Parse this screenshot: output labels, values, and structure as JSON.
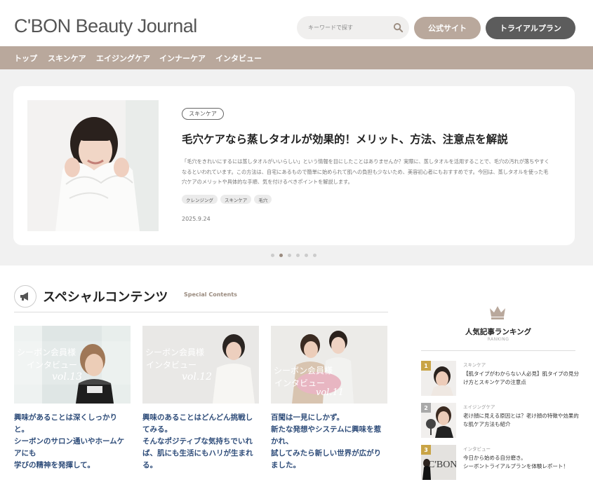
{
  "header": {
    "logo": "C'BON Beauty Journal",
    "search_placeholder": "キーワードで探す",
    "official_label": "公式サイト",
    "trial_label": "トライアルプラン"
  },
  "nav": {
    "items": [
      "トップ",
      "スキンケア",
      "エイジングケア",
      "インナーケア",
      "インタビュー"
    ]
  },
  "hero": {
    "tag": "スキンケア",
    "title": "毛穴ケアなら蒸しタオルが効果的！メリット、方法、注意点を解説",
    "description": "「毛穴をきれいにするには蒸しタオルがいいらしい」という情報を目にしたことはありませんか？実際に、蒸しタオルを活用することで、毛穴の汚れが落ちやすくなるといわれています。この方法は、自宅にあるもので簡単に始められて肌への負担も少ないため、美容初心者にもおすすめです。今回は、蒸しタオルを使った毛穴ケアのメリットや具体的な手順、気を付けるべきポイントを解説します。",
    "pills": [
      "クレンジング",
      "スキンケア",
      "毛穴"
    ],
    "date": "2025.9.24"
  },
  "special": {
    "title": "スペシャルコンテンツ",
    "subtitle": "Special Contents",
    "cards": [
      {
        "overlay_line1": "シーボン会員様",
        "overlay_line2": "インタビュー",
        "vol": "vol.13",
        "text": "興味があることは深くしっかりと。\nシーボンのサロン通いやホームケアにも\n学びの精神を発揮して。"
      },
      {
        "overlay_line1": "シーボン会員様",
        "overlay_line2": "インタビュー",
        "vol": "vol.12",
        "text": "興味のあることはどんどん挑戦してみる。\nそんなポジティブな気持ちでいれば、肌にも生活にもハリが生まれる。"
      },
      {
        "overlay_line1": "シーボン会員様",
        "overlay_line2": "インタビュー",
        "vol": "vol.11",
        "text": "百聞は一見にしかず。\n新たな発想やシステムに興味を惹かれ、\n試してみたら新しい世界が広がりました。"
      }
    ]
  },
  "ranking": {
    "title": "人気記事ランキング",
    "subtitle": "RANKING",
    "items": [
      {
        "rank": "1",
        "category": "スキンケア",
        "text": "【肌タイプがわからない人必見】肌タイプの見分け方とスキンケアの注意点"
      },
      {
        "rank": "2",
        "category": "エイジングケア",
        "text": "老け顔に見える原因とは？老け顔の特徴や効果的な肌ケア方法も紹介"
      },
      {
        "rank": "3",
        "category": "インタビュー",
        "text": "今日から始める自分磨き。\nシーボントライアルプランを体験レポート！"
      }
    ],
    "thumb3_text": "C'BON"
  },
  "colors": {
    "accent": "#b9a89c",
    "dark_button": "#5c5c5c",
    "link_blue": "#2f4d7a",
    "gold": "#c9a446"
  }
}
